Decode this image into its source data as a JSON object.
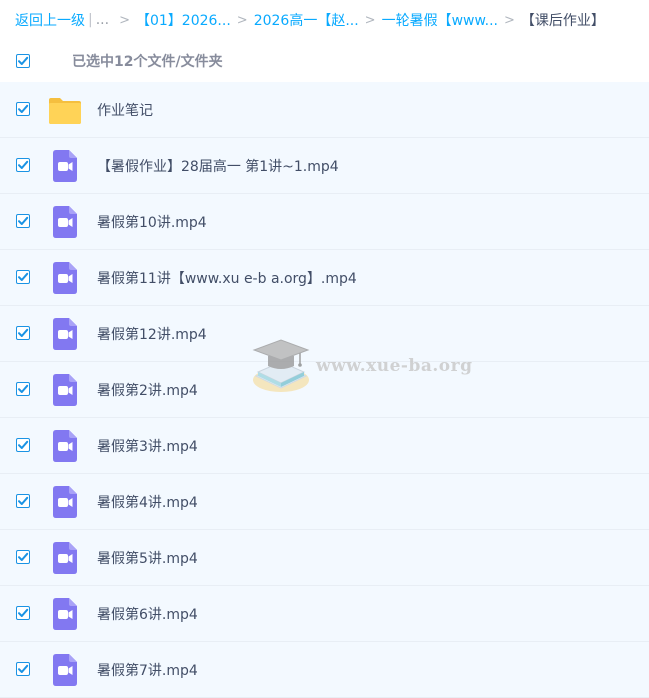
{
  "breadcrumb": {
    "back": "返回上一级",
    "separator": "|",
    "ellipsis": "...",
    "arrow": ">",
    "items": [
      "【01】2026...",
      "2026高一【赵...",
      "一轮暑假【www..."
    ],
    "current": "【课后作业】"
  },
  "selection": {
    "label": "已选中12个文件/文件夹",
    "all_checked": true
  },
  "files": [
    {
      "name": "作业笔记",
      "type": "folder",
      "checked": true
    },
    {
      "name": "【暑假作业】28届高一 第1讲~1.mp4",
      "type": "video",
      "checked": true
    },
    {
      "name": "暑假第10讲.mp4",
      "type": "video",
      "checked": true
    },
    {
      "name": "暑假第11讲【www.xu e-b a.org】.mp4",
      "type": "video",
      "checked": true
    },
    {
      "name": "暑假第12讲.mp4",
      "type": "video",
      "checked": true
    },
    {
      "name": "暑假第2讲.mp4",
      "type": "video",
      "checked": true
    },
    {
      "name": "暑假第3讲.mp4",
      "type": "video",
      "checked": true
    },
    {
      "name": "暑假第4讲.mp4",
      "type": "video",
      "checked": true
    },
    {
      "name": "暑假第5讲.mp4",
      "type": "video",
      "checked": true
    },
    {
      "name": "暑假第6讲.mp4",
      "type": "video",
      "checked": true
    },
    {
      "name": "暑假第7讲.mp4",
      "type": "video",
      "checked": true
    }
  ],
  "watermark": {
    "text": "www.xue-ba.org",
    "icon": "graduation-cap-books-icon"
  },
  "colors": {
    "link": "#09aaff",
    "checkbox": "#1a93e4",
    "row_background": "#f3f9ff",
    "folder": "#ffd357",
    "video": "#8278f1"
  }
}
